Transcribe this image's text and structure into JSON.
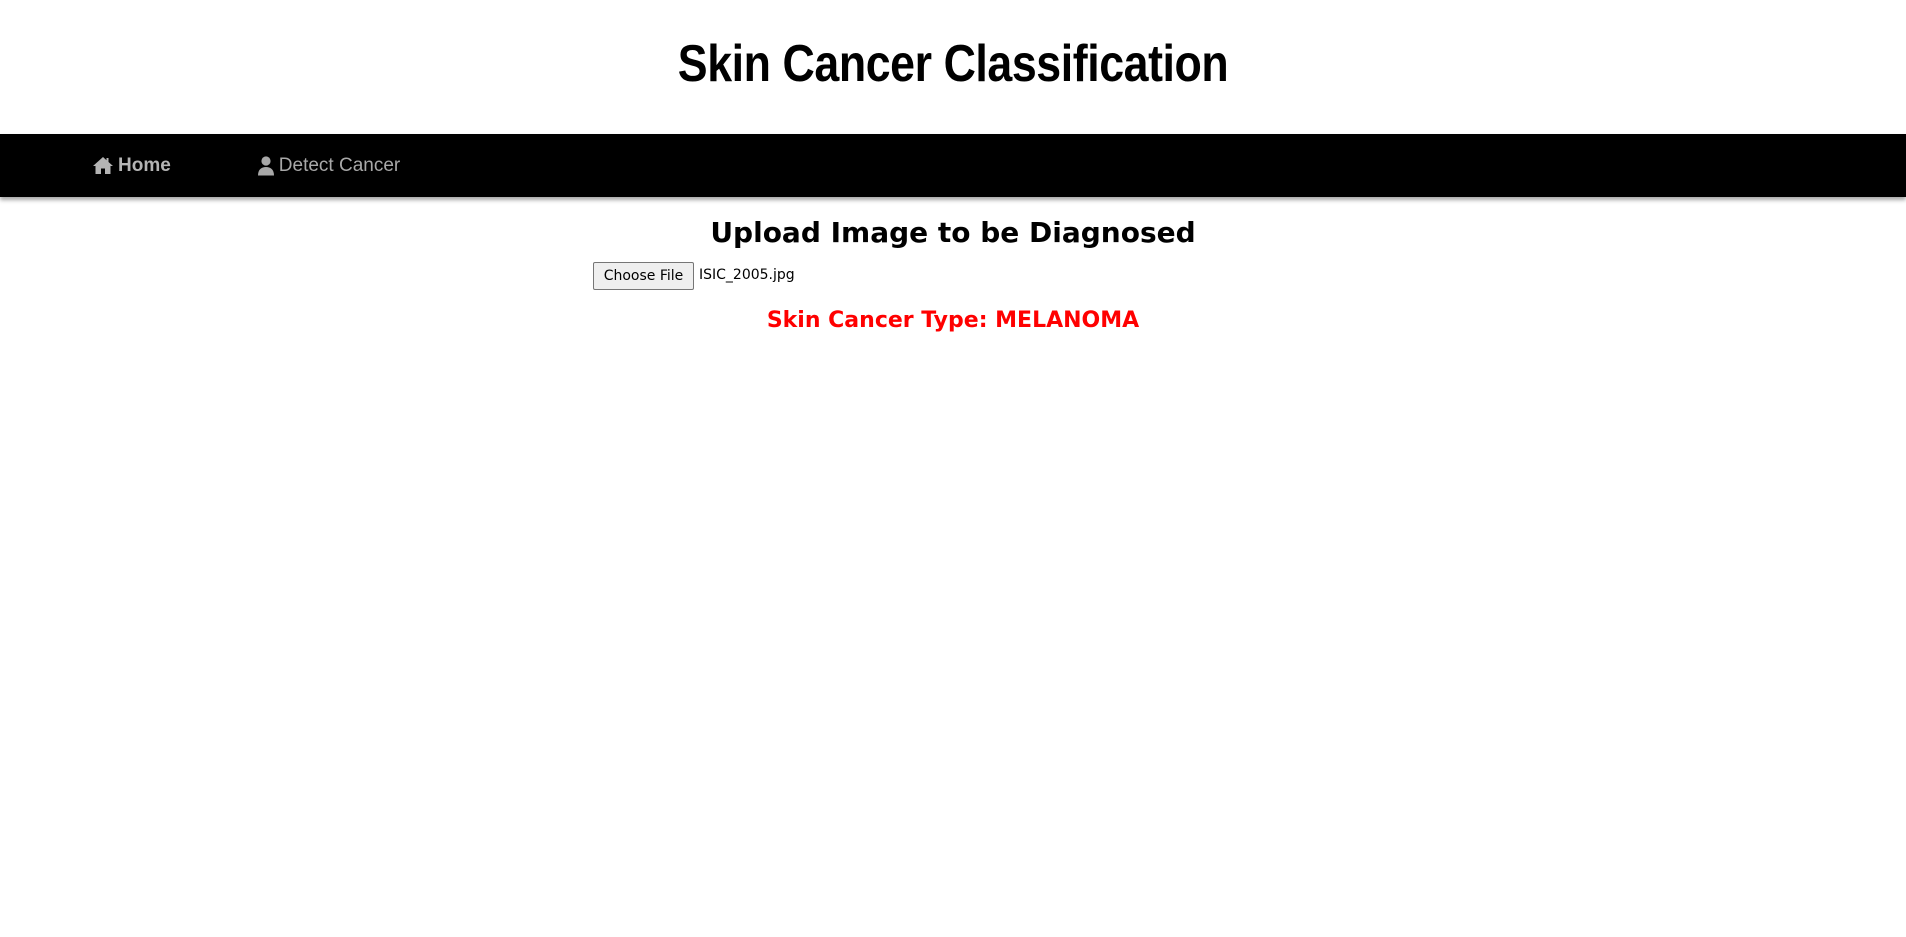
{
  "header": {
    "title": "Skin Cancer Classification"
  },
  "nav": {
    "items": [
      {
        "label": "Home",
        "icon": "home-icon"
      },
      {
        "label": "Detect Cancer",
        "icon": "user-icon"
      }
    ]
  },
  "main": {
    "upload_title": "Upload Image to be Diagnosed",
    "file_input": {
      "button_label": "Choose File",
      "selected_file": "ISIC_2005.jpg"
    },
    "result": {
      "text": "Skin Cancer Type: MELANOMA",
      "color": "#ff0000"
    }
  },
  "colors": {
    "navbar_bg": "#000000",
    "nav_text": "#9d9d9d",
    "page_bg": "#ffffff"
  }
}
